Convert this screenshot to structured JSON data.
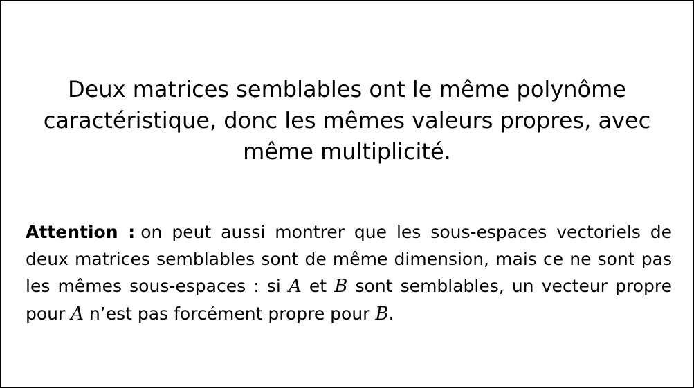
{
  "statement": "Deux matrices semblables ont le même polynôme caractéristique, donc les mêmes valeurs propres, avec même multiplicité.",
  "note": {
    "label": "Attention :",
    "part1": "on peut aussi montrer que les sous-espaces vectoriels de deux matrices semblables sont de même dimension, mais ce ne sont pas les mêmes sous-espaces : si ",
    "var_a": "A",
    "part2": " et ",
    "var_b": "B",
    "part3": " sont semblables, un vecteur propre pour ",
    "var_a2": "A",
    "part4": " n’est pas forcément propre pour ",
    "var_b2": "B",
    "part5": "."
  }
}
